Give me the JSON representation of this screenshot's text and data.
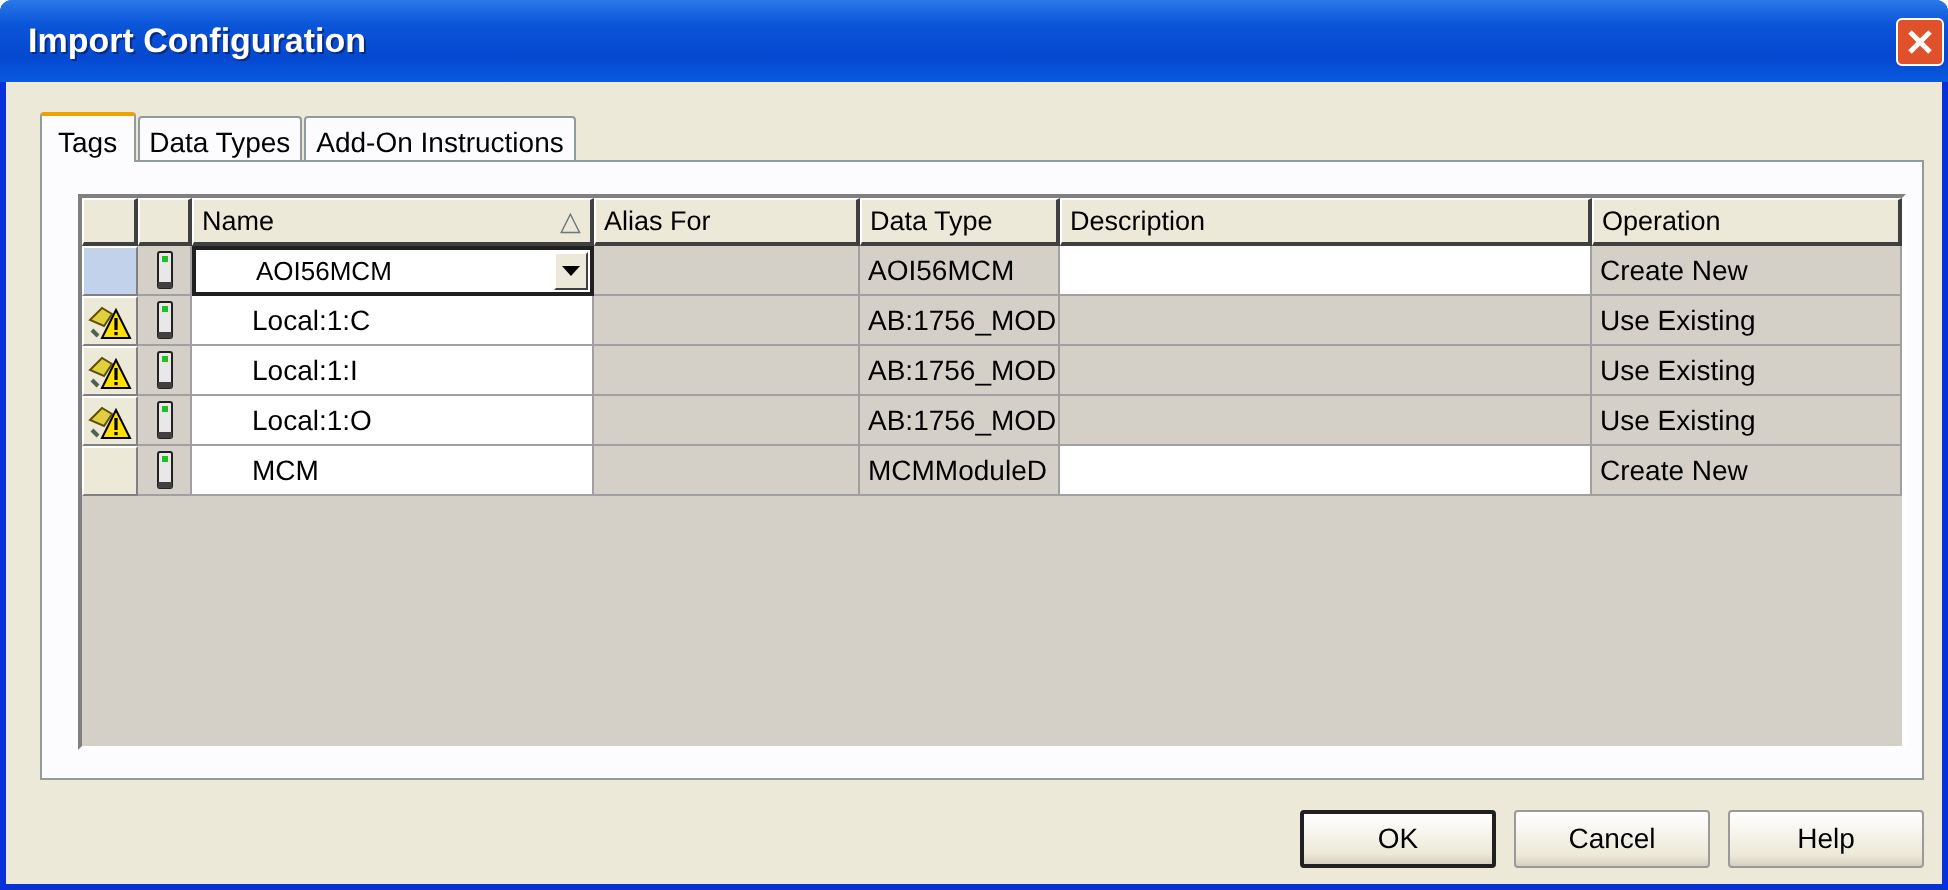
{
  "window": {
    "title": "Import Configuration"
  },
  "tabs": [
    {
      "label": "Tags",
      "selected": true
    },
    {
      "label": "Data Types",
      "selected": false
    },
    {
      "label": "Add-On Instructions",
      "selected": false
    }
  ],
  "table": {
    "columns": [
      {
        "label": "Name",
        "sort_mark": "△"
      },
      {
        "label": "Alias For"
      },
      {
        "label": "Data Type"
      },
      {
        "label": "Description"
      },
      {
        "label": "Operation"
      }
    ],
    "rows": [
      {
        "selected": true,
        "warning": false,
        "name": "AOI56MCM",
        "data_type": "AOI56MCM",
        "description_editable": true,
        "operation": "Create New"
      },
      {
        "selected": false,
        "warning": true,
        "name": "Local:1:C",
        "data_type": "AB:1756_MOD",
        "description_editable": false,
        "operation": "Use Existing"
      },
      {
        "selected": false,
        "warning": true,
        "name": "Local:1:I",
        "data_type": "AB:1756_MOD",
        "description_editable": false,
        "operation": "Use Existing"
      },
      {
        "selected": false,
        "warning": true,
        "name": "Local:1:O",
        "data_type": "AB:1756_MOD",
        "description_editable": false,
        "operation": "Use Existing"
      },
      {
        "selected": false,
        "warning": false,
        "name": "MCM",
        "data_type": "MCMModuleD",
        "description_editable": true,
        "operation": "Create New"
      }
    ]
  },
  "buttons": [
    {
      "label": "OK",
      "default": true
    },
    {
      "label": "Cancel",
      "default": false
    },
    {
      "label": "Help",
      "default": false
    }
  ]
}
